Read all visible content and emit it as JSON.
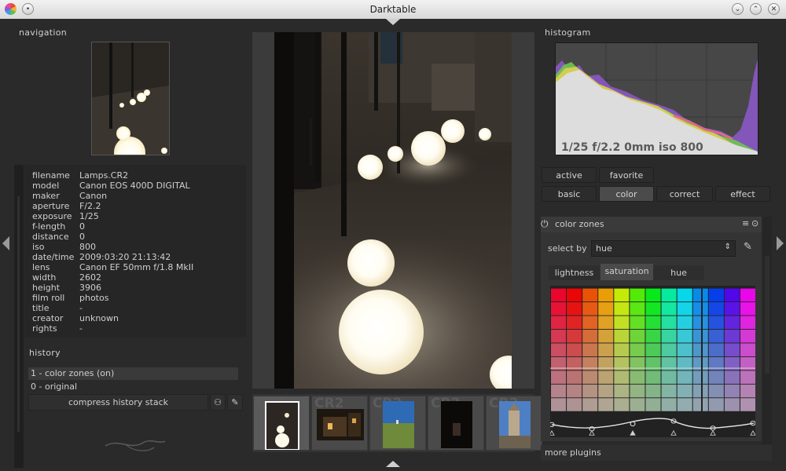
{
  "window": {
    "title": "Darktable"
  },
  "navigation": {
    "title": "navigation"
  },
  "image_info": {
    "rows": [
      {
        "key": "filename",
        "value": "Lamps.CR2"
      },
      {
        "key": "model",
        "value": "Canon EOS 400D DIGITAL"
      },
      {
        "key": "maker",
        "value": "Canon"
      },
      {
        "key": "aperture",
        "value": "F/2.2"
      },
      {
        "key": "exposure",
        "value": "1/25"
      },
      {
        "key": "f-length",
        "value": "0"
      },
      {
        "key": "distance",
        "value": "0"
      },
      {
        "key": "iso",
        "value": "800"
      },
      {
        "key": "date/time",
        "value": "2009:03:20 21:13:42"
      },
      {
        "key": "lens",
        "value": "Canon EF 50mm f/1.8 MkII"
      },
      {
        "key": "width",
        "value": "2602"
      },
      {
        "key": "height",
        "value": "3906"
      },
      {
        "key": "film roll",
        "value": "photos"
      },
      {
        "key": "title",
        "value": "-"
      },
      {
        "key": "creator",
        "value": "unknown"
      },
      {
        "key": "rights",
        "value": "-"
      }
    ]
  },
  "history": {
    "title": "history",
    "items": [
      "1 - color zones (on)",
      "0 - original"
    ],
    "compress_label": "compress history stack"
  },
  "filmstrip": {
    "ext_label": "CR2"
  },
  "histogram": {
    "title": "histogram",
    "exif_line": "1/25 f/2.2 0mm iso 800"
  },
  "module_groups": {
    "row1": [
      "active",
      "favorite"
    ],
    "row2": [
      "basic",
      "color",
      "correct",
      "effect"
    ],
    "selected": "color"
  },
  "color_zones": {
    "title": "color zones",
    "select_by_label": "select by",
    "select_by_value": "hue",
    "tabs": [
      "lightness",
      "saturation",
      "hue"
    ],
    "active_tab": "saturation"
  },
  "more_plugins": {
    "label": "more plugins"
  }
}
